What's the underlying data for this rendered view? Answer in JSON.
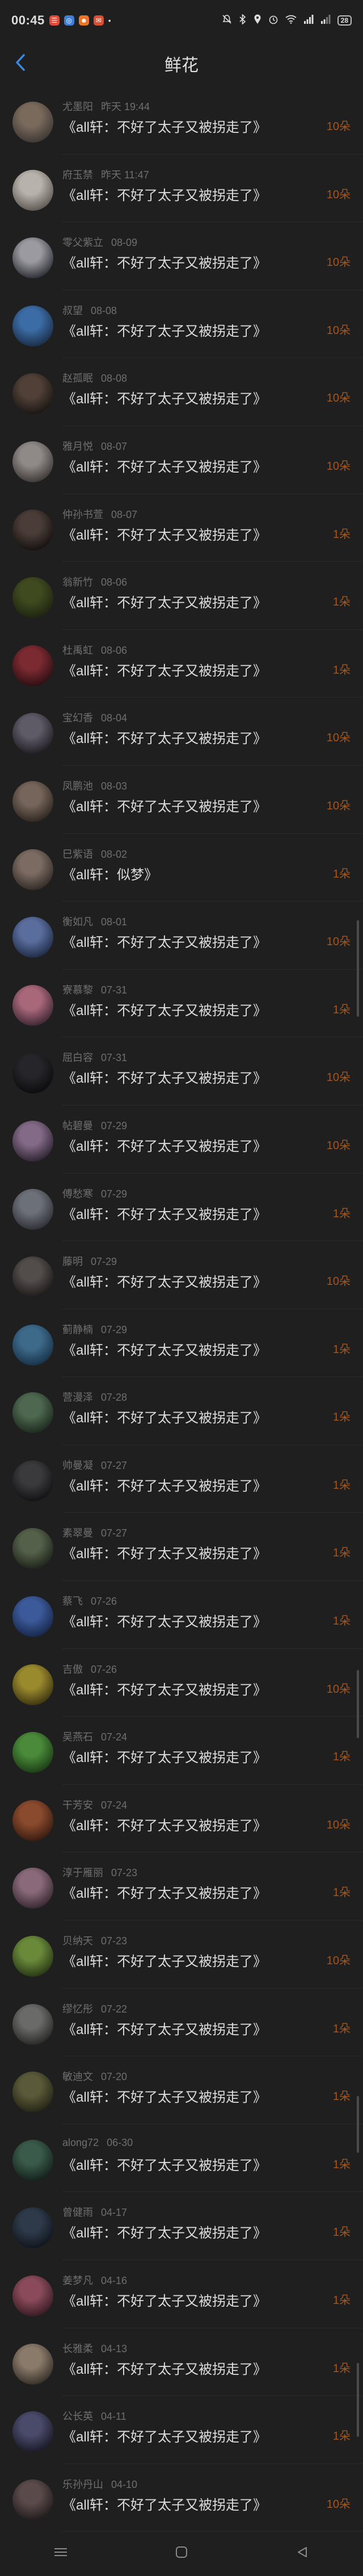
{
  "status_bar": {
    "time": "00:45",
    "app_icons": [
      {
        "name": "app-icon-1",
        "color": "#e24b3b",
        "glyph": "☰"
      },
      {
        "name": "app-icon-2",
        "color": "#3f7fd8",
        "glyph": "◎"
      },
      {
        "name": "app-icon-3",
        "color": "#e9742b",
        "glyph": "☻"
      },
      {
        "name": "app-icon-4",
        "color": "#d94f2f",
        "glyph": "✉"
      }
    ],
    "dot": "•",
    "battery": "28"
  },
  "header": {
    "title": "鲜花"
  },
  "colors": {
    "background": "#1f1f1f",
    "accent_back": "#3a8be0",
    "flower_count": "#a3561f"
  },
  "list": [
    {
      "name": "尤墨阳",
      "time": "昨天 19:44",
      "msg": "《all轩：不好了太子又被拐走了》",
      "count": "10朵",
      "avatar": [
        "#7a6a5c",
        "#3b3632"
      ]
    },
    {
      "name": "府玉禁",
      "time": "昨天 11:47",
      "msg": "《all轩：不好了太子又被拐走了》",
      "count": "10朵",
      "avatar": [
        "#b8b2ac",
        "#5a5550"
      ]
    },
    {
      "name": "零父紫立",
      "time": "08-09",
      "msg": "《all轩：不好了太子又被拐走了》",
      "count": "10朵",
      "avatar": [
        "#9b9aa0",
        "#2a2b33"
      ]
    },
    {
      "name": "叔望",
      "time": "08-08",
      "msg": "《all轩：不好了太子又被拐走了》",
      "count": "10朵",
      "avatar": [
        "#3c6ca5",
        "#1a2c45"
      ]
    },
    {
      "name": "赵孤眠",
      "time": "08-08",
      "msg": "《all轩：不好了太子又被拐走了》",
      "count": "10朵",
      "avatar": [
        "#514038",
        "#191512"
      ]
    },
    {
      "name": "雅月悦",
      "time": "08-07",
      "msg": "《all轩：不好了太子又被拐走了》",
      "count": "10朵",
      "avatar": [
        "#8f8a87",
        "#3b3634"
      ]
    },
    {
      "name": "仲孙书萱",
      "time": "08-07",
      "msg": "《all轩：不好了太子又被拐走了》",
      "count": "1朵",
      "avatar": [
        "#4a3d38",
        "#14100e"
      ]
    },
    {
      "name": "翁新竹",
      "time": "08-06",
      "msg": "《all轩：不好了太子又被拐走了》",
      "count": "1朵",
      "avatar": [
        "#3f4a1f",
        "#1c2310"
      ]
    },
    {
      "name": "杜禹虹",
      "time": "08-06",
      "msg": "《all轩：不好了太子又被拐走了》",
      "count": "1朵",
      "avatar": [
        "#7a2a30",
        "#2a0e12"
      ]
    },
    {
      "name": "宝幻香",
      "time": "08-04",
      "msg": "《all轩：不好了太子又被拐走了》",
      "count": "10朵",
      "avatar": [
        "#5e5a66",
        "#1e1c22"
      ]
    },
    {
      "name": "凤鹏池",
      "time": "08-03",
      "msg": "《all轩：不好了太子又被拐走了》",
      "count": "10朵",
      "avatar": [
        "#75655a",
        "#2c241f"
      ]
    },
    {
      "name": "巳紫语",
      "time": "08-02",
      "msg": "《all轩：似梦》",
      "count": "1朵",
      "avatar": [
        "#7b6b63",
        "#302824"
      ]
    },
    {
      "name": "衡如凡",
      "time": "08-01",
      "msg": "《all轩：不好了太子又被拐走了》",
      "count": "10朵",
      "avatar": [
        "#5a6e9e",
        "#1e2a44"
      ]
    },
    {
      "name": "寮慕黎",
      "time": "07-31",
      "msg": "《all轩：不好了太子又被拐走了》",
      "count": "1朵",
      "avatar": [
        "#a8687a",
        "#3b2430"
      ]
    },
    {
      "name": "屈白容",
      "time": "07-31",
      "msg": "《all轩：不好了太子又被拐走了》",
      "count": "10朵",
      "avatar": [
        "#26262a",
        "#0b0b0d"
      ]
    },
    {
      "name": "帖碧曼",
      "time": "07-29",
      "msg": "《all轩：不好了太子又被拐走了》",
      "count": "10朵",
      "avatar": [
        "#836a86",
        "#2b2230"
      ]
    },
    {
      "name": "傅愁寒",
      "time": "07-29",
      "msg": "《all轩：不好了太子又被拐走了》",
      "count": "1朵",
      "avatar": [
        "#6c7078",
        "#2c2e33"
      ]
    },
    {
      "name": "藤明",
      "time": "07-29",
      "msg": "《all轩：不好了太子又被拐走了》",
      "count": "10朵",
      "avatar": [
        "#524c4a",
        "#1a1817"
      ]
    },
    {
      "name": "蓟静楠",
      "time": "07-29",
      "msg": "《all轩：不好了太子又被拐走了》",
      "count": "1朵",
      "avatar": [
        "#3e6a8a",
        "#163046"
      ]
    },
    {
      "name": "营漫泽",
      "time": "07-28",
      "msg": "《all轩：不好了太子又被拐走了》",
      "count": "1朵",
      "avatar": [
        "#4e6850",
        "#1b281c"
      ]
    },
    {
      "name": "帅曼凝",
      "time": "07-27",
      "msg": "《all轩：不好了太子又被拐走了》",
      "count": "1朵",
      "avatar": [
        "#3a3a3c",
        "#111113"
      ]
    },
    {
      "name": "素翠曼",
      "time": "07-27",
      "msg": "《all轩：不好了太子又被拐走了》",
      "count": "1朵",
      "avatar": [
        "#55604a",
        "#1c2218"
      ]
    },
    {
      "name": "蔡飞",
      "time": "07-26",
      "msg": "《all轩：不好了太子又被拐走了》",
      "count": "1朵",
      "avatar": [
        "#3c5a9a",
        "#152546"
      ]
    },
    {
      "name": "吉傲",
      "time": "07-26",
      "msg": "《all轩：不好了太子又被拐走了》",
      "count": "10朵",
      "avatar": [
        "#9a8a2e",
        "#3a3210"
      ]
    },
    {
      "name": "吴燕石",
      "time": "07-24",
      "msg": "《all轩：不好了太子又被拐走了》",
      "count": "1朵",
      "avatar": [
        "#4a8a3a",
        "#1a3a14"
      ]
    },
    {
      "name": "干芳安",
      "time": "07-24",
      "msg": "《all轩：不好了太子又被拐走了》",
      "count": "10朵",
      "avatar": [
        "#8a4a2e",
        "#361a0f"
      ]
    },
    {
      "name": "淳于雁丽",
      "time": "07-23",
      "msg": "《all轩：不好了太子又被拐走了》",
      "count": "1朵",
      "avatar": [
        "#8a6a7a",
        "#34262e"
      ]
    },
    {
      "name": "贝纳天",
      "time": "07-23",
      "msg": "《all轩：不好了太子又被拐走了》",
      "count": "10朵",
      "avatar": [
        "#6a8a3a",
        "#263414"
      ]
    },
    {
      "name": "缪忆彤",
      "time": "07-22",
      "msg": "《all轩：不好了太子又被拐走了》",
      "count": "1朵",
      "avatar": [
        "#6a6a68",
        "#262624"
      ]
    },
    {
      "name": "敏迪文",
      "time": "07-20",
      "msg": "《all轩：不好了太子又被拐走了》",
      "count": "1朵",
      "avatar": [
        "#5a5a3a",
        "#222214"
      ]
    },
    {
      "name": "along72",
      "time": "06-30",
      "msg": "《all轩：不好了太子又被拐走了》",
      "count": "1朵",
      "avatar": [
        "#3a5a4a",
        "#13211b"
      ]
    },
    {
      "name": "曾健雨",
      "time": "04-17",
      "msg": "《all轩：不好了太子又被拐走了》",
      "count": "1朵",
      "avatar": [
        "#2e3a4a",
        "#0f141b"
      ]
    },
    {
      "name": "姜梦凡",
      "time": "04-16",
      "msg": "《all轩：不好了太子又被拐走了》",
      "count": "1朵",
      "avatar": [
        "#8a4a5a",
        "#341a22"
      ]
    },
    {
      "name": "长雅柔",
      "time": "04-13",
      "msg": "《all轩：不好了太子又被拐走了》",
      "count": "1朵",
      "avatar": [
        "#8a7a6a",
        "#342d26"
      ]
    },
    {
      "name": "公长英",
      "time": "04-11",
      "msg": "《all轩：不好了太子又被拐走了》",
      "count": "1朵",
      "avatar": [
        "#4a4a6a",
        "#181826"
      ]
    },
    {
      "name": "乐孙丹山",
      "time": "04-10",
      "msg": "《all轩：不好了太子又被拐走了》",
      "count": "10朵",
      "avatar": [
        "#5a4a4a",
        "#201a1a"
      ]
    }
  ],
  "nav": {
    "menu_glyph": "≡",
    "home_glyph": "□",
    "back_glyph": "◁"
  }
}
